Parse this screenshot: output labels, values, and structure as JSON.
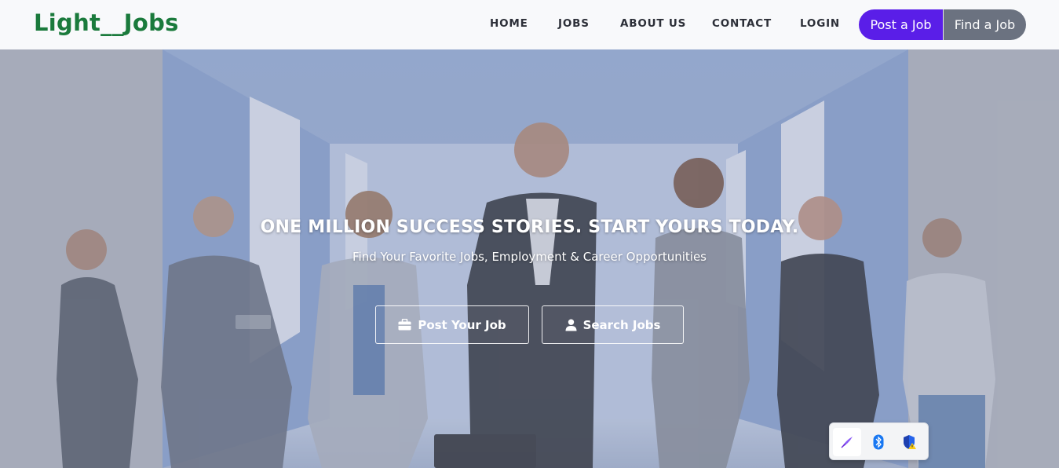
{
  "brand": {
    "name": "Light__Jobs",
    "color": "#1a7a3c"
  },
  "nav": {
    "items": [
      {
        "label": "HOME"
      },
      {
        "label": "JOBS"
      },
      {
        "label": "ABOUT US"
      },
      {
        "label": "CONTACT"
      },
      {
        "label": "LOGIN"
      }
    ],
    "post_job_label": "Post a Job",
    "find_job_label": "Find a Job",
    "post_job_color": "#5a1ee8",
    "find_job_color": "#6b7280"
  },
  "hero": {
    "title": "ONE MILLION SUCCESS STORIES. START YOURS TODAY.",
    "subtitle": "Find Your Favorite Jobs, Employment & Career Opportunities",
    "post_button": {
      "label": "Post Your Job",
      "icon": "briefcase-icon"
    },
    "search_button": {
      "label": "Search Jobs",
      "icon": "user-icon"
    }
  },
  "tray": {
    "icons": [
      "pen-icon",
      "bluetooth-icon",
      "security-shield-icon"
    ]
  }
}
